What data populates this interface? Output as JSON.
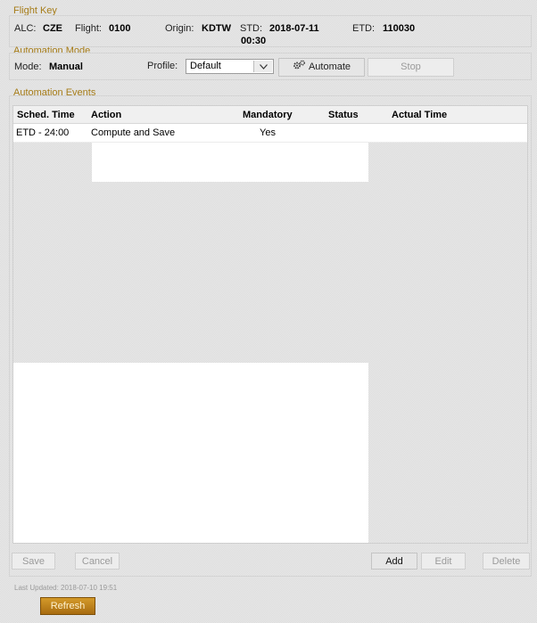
{
  "flight_key": {
    "legend": "Flight Key",
    "alc_label": "ALC:",
    "alc_value": "CZE",
    "flight_label": "Flight:",
    "flight_value": "0100",
    "origin_label": "Origin:",
    "origin_value": "KDTW",
    "std_label": "STD:",
    "std_value_line1": "2018-07-11",
    "std_value_line2": "00:30",
    "etd_label": "ETD:",
    "etd_value": "110030"
  },
  "automation_mode": {
    "legend": "Automation Mode",
    "mode_label": "Mode:",
    "mode_value": "Manual",
    "profile_label": "Profile:",
    "profile_selected": "Default",
    "automate_label": "Automate",
    "stop_label": "Stop"
  },
  "automation_events": {
    "legend": "Automation Events",
    "columns": [
      "Sched. Time",
      "Action",
      "Mandatory",
      "Status",
      "Actual Time"
    ],
    "rows": [
      {
        "sched_time": "ETD - 24:00",
        "action": "Compute and Save",
        "mandatory": "Yes",
        "status": "",
        "actual_time": ""
      }
    ]
  },
  "buttons": {
    "save": "Save",
    "cancel": "Cancel",
    "add": "Add",
    "edit": "Edit",
    "delete": "Delete",
    "refresh": "Refresh"
  },
  "footer": {
    "last_updated": "Last Updated: 2018-07-10 19:51"
  },
  "colors": {
    "legend": "#a67c18",
    "refresh_button": "#c08420"
  }
}
